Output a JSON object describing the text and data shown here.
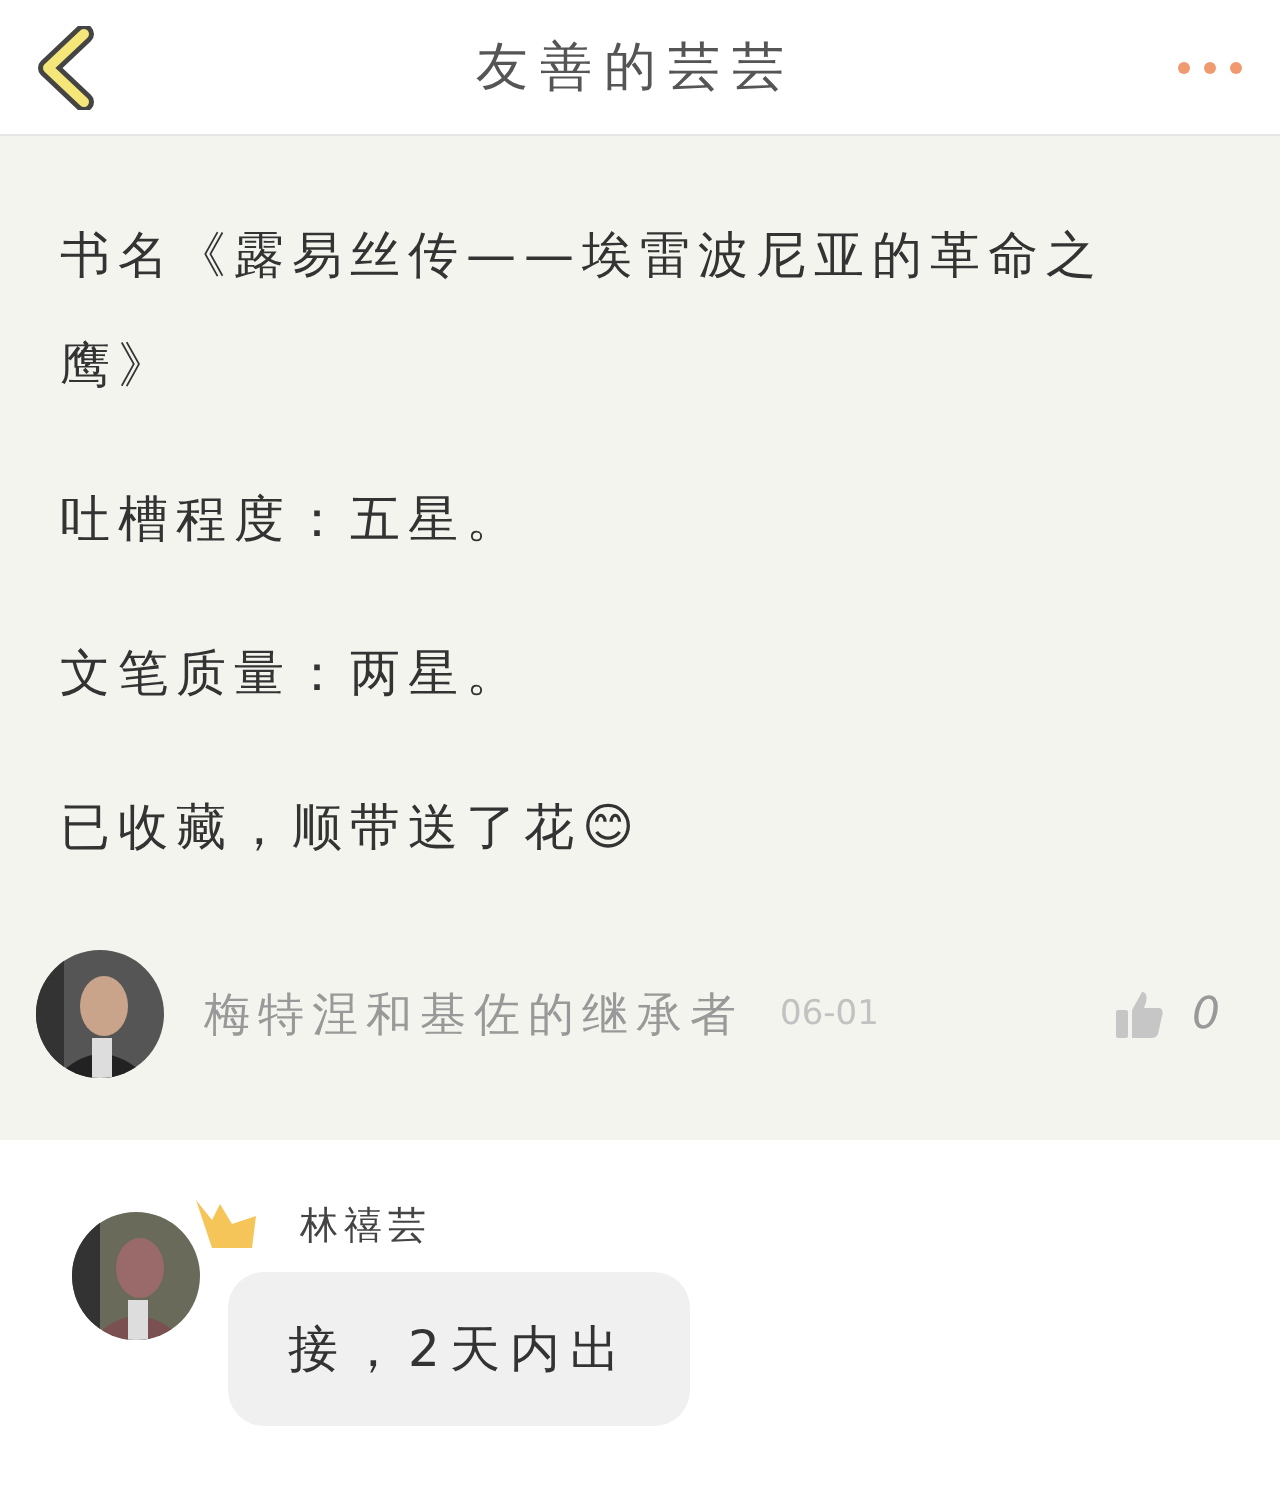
{
  "header": {
    "title": "友善的芸芸"
  },
  "post": {
    "paragraphs": [
      "书名《露易丝传——埃雷波尼亚的革命之鹰》",
      "吐槽程度：五星。",
      "文笔质量：两星。",
      "已收藏，顺带送了花😊"
    ],
    "author": {
      "name": "梅特涅和基佐的继承者",
      "date": "06-01",
      "likes": "0",
      "liked": false
    }
  },
  "reply": {
    "name": "林禧芸",
    "crown": true,
    "message": "接，2天内出"
  }
}
